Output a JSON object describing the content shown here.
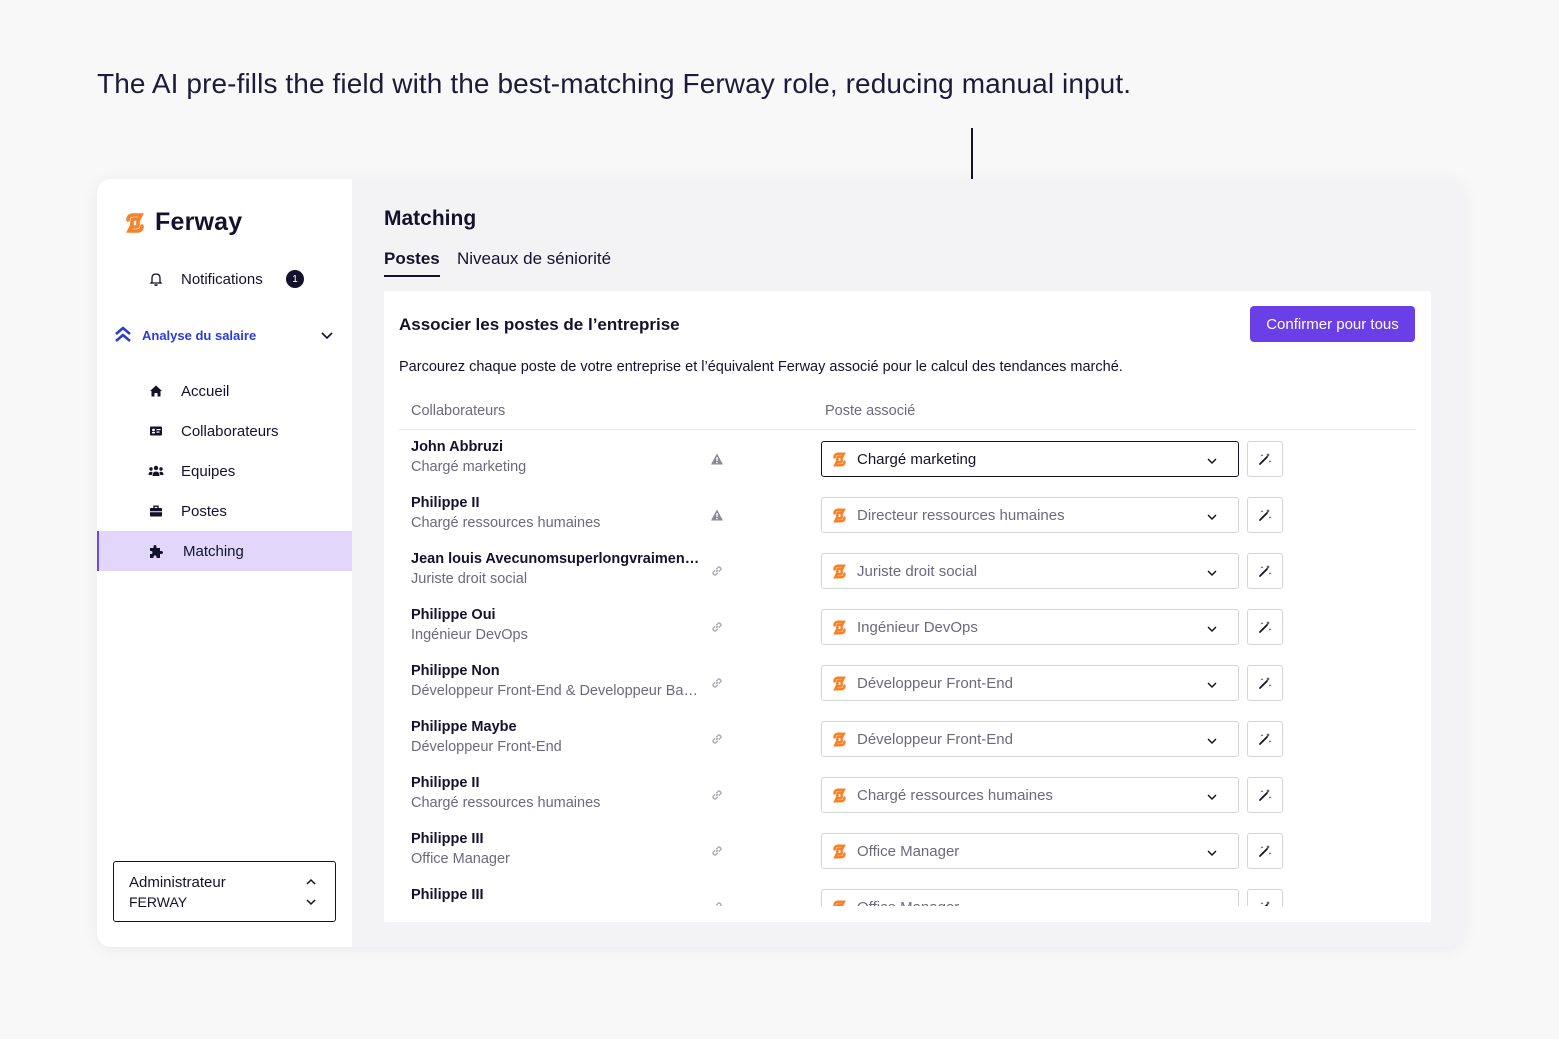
{
  "caption": "The AI pre-fills the field with the best-matching Ferway role, reducing manual input.",
  "brand": {
    "name": "Ferway",
    "accent": "#f7812a",
    "primary": "#6a3fe8"
  },
  "sidebar": {
    "notifications": {
      "label": "Notifications",
      "count": "1",
      "icon": "bell-icon"
    },
    "section": {
      "label": "Analyse du salaire",
      "icon": "ferway-chevrons-icon"
    },
    "items": [
      {
        "label": "Accueil",
        "icon": "home-icon",
        "active": false
      },
      {
        "label": "Collaborateurs",
        "icon": "id-card-icon",
        "active": false
      },
      {
        "label": "Equipes",
        "icon": "team-icon",
        "active": false
      },
      {
        "label": "Postes",
        "icon": "briefcase-icon",
        "active": false
      },
      {
        "label": "Matching",
        "icon": "puzzle-icon",
        "active": true
      }
    ],
    "user": {
      "role": "Administrateur",
      "company": "FERWAY"
    }
  },
  "main": {
    "title": "Matching",
    "tabs": [
      {
        "label": "Postes",
        "active": true
      },
      {
        "label": "Niveaux de séniorité",
        "active": false
      }
    ],
    "card": {
      "title": "Associer les postes de l’entreprise",
      "confirm_label": "Confirmer pour tous",
      "description": "Parcourez chaque poste de votre entreprise et l’équivalent Ferway associé pour le calcul des tendances marché.",
      "col_employees": "Collaborateurs",
      "col_position": "Poste associé",
      "rows": [
        {
          "name": "John Abbruzi",
          "role": "Chargé marketing",
          "status": "warning-icon",
          "match": "Chargé marketing",
          "focused": true
        },
        {
          "name": "Philippe II",
          "role": "Chargé ressources humaines",
          "status": "warning-icon",
          "match": "Directeur ressources humaines",
          "focused": false
        },
        {
          "name": "Jean louis Avecunomsuperlongvraimentlong",
          "role": "Juriste droit social",
          "status": "link-icon",
          "match": "Juriste droit social",
          "focused": false
        },
        {
          "name": "Philippe Oui",
          "role": "Ingénieur DevOps",
          "status": "link-icon",
          "match": "Ingénieur DevOps",
          "focused": false
        },
        {
          "name": "Philippe Non",
          "role": "Développeur Front-End & Developpeur Back-End",
          "status": "link-icon",
          "match": "Développeur Front-End",
          "focused": false
        },
        {
          "name": "Philippe Maybe",
          "role": "Développeur Front-End",
          "status": "link-icon",
          "match": "Développeur Front-End",
          "focused": false
        },
        {
          "name": "Philippe II",
          "role": "Chargé ressources humaines",
          "status": "link-icon",
          "match": "Chargé ressources humaines",
          "focused": false
        },
        {
          "name": "Philippe III",
          "role": "Office Manager",
          "status": "link-icon",
          "match": "Office Manager",
          "focused": false
        },
        {
          "name": "Philippe III",
          "role": "",
          "status": "link-icon",
          "match": "Office Manager",
          "focused": false
        }
      ]
    }
  }
}
